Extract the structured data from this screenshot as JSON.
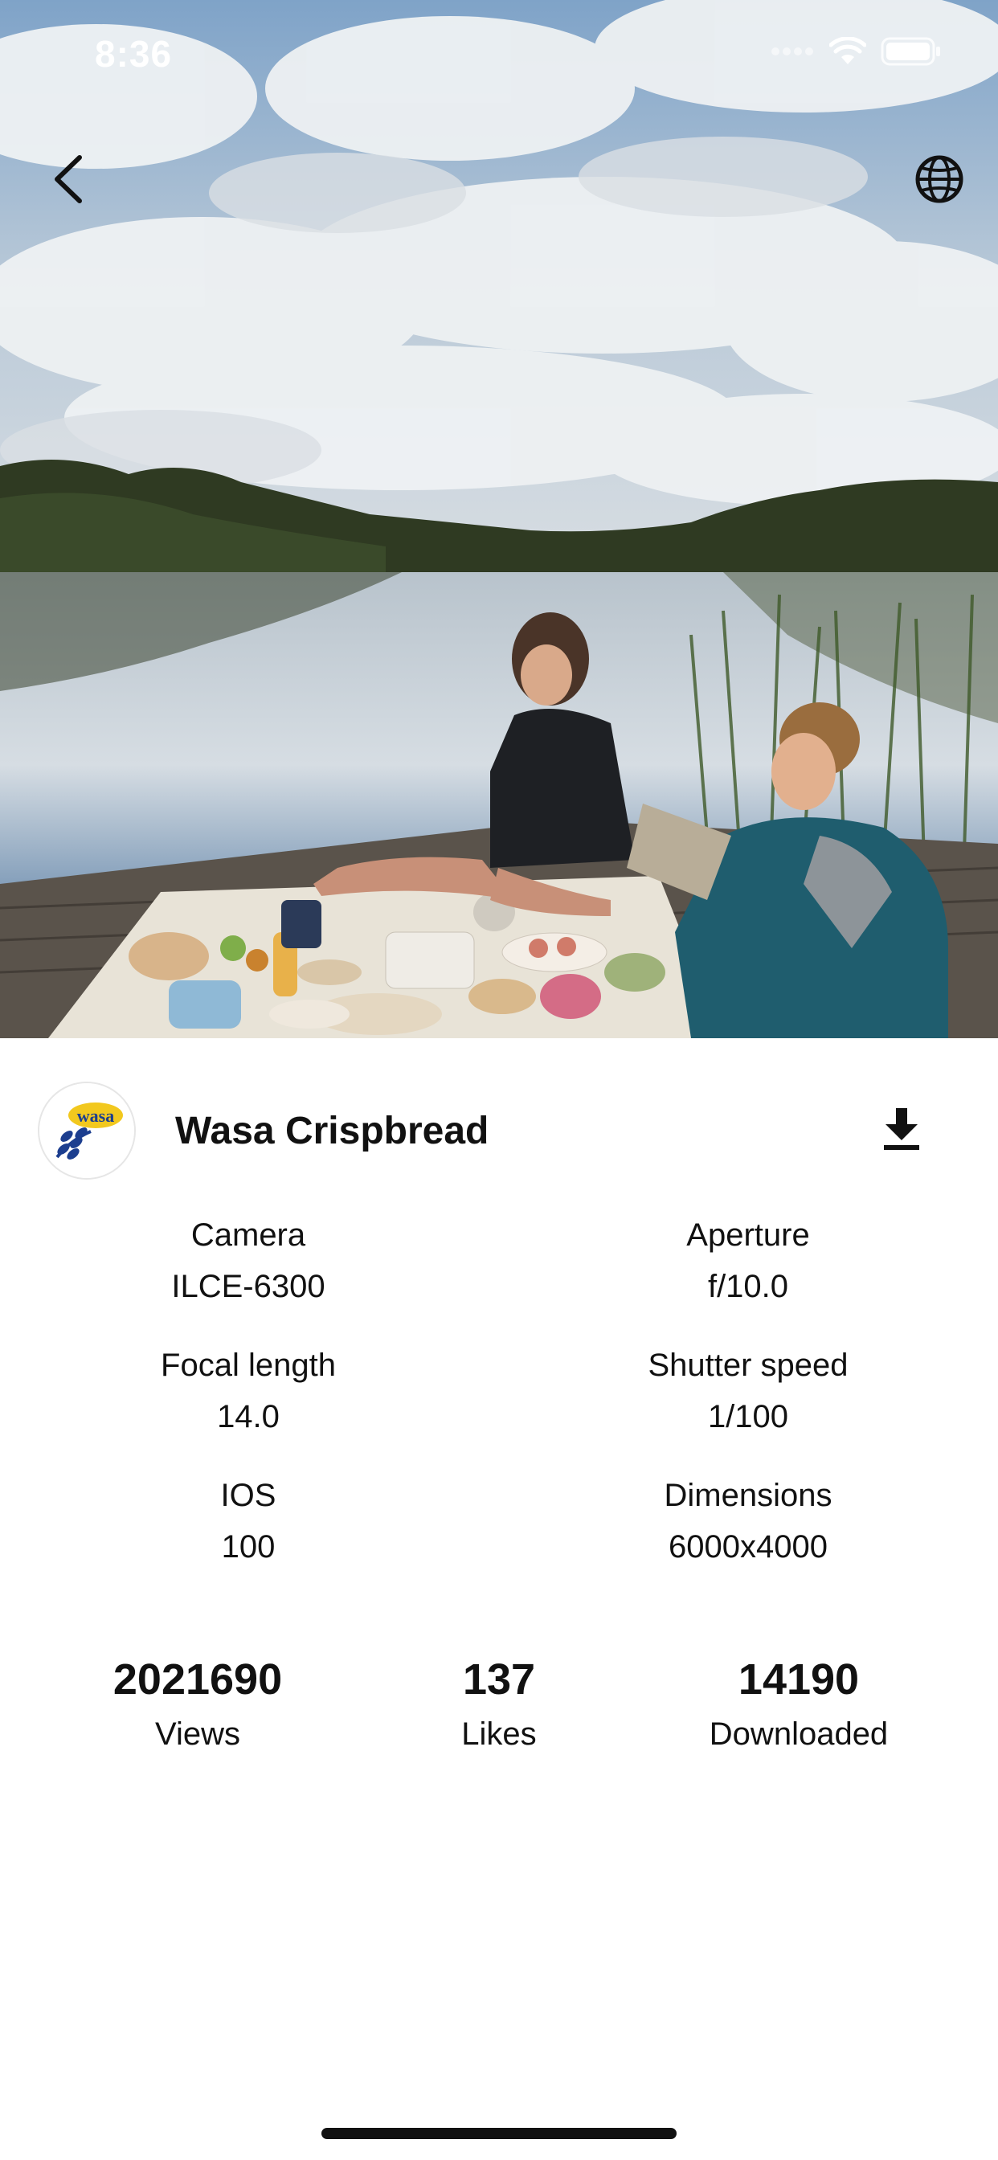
{
  "status_bar": {
    "time": "8:36"
  },
  "author": {
    "name": "Wasa Crispbread",
    "avatar_text": "wasa"
  },
  "exif": [
    {
      "label": "Camera",
      "value": "ILCE-6300"
    },
    {
      "label": "Aperture",
      "value": "f/10.0"
    },
    {
      "label": "Focal length",
      "value": "14.0"
    },
    {
      "label": "Shutter speed",
      "value": "1/100"
    },
    {
      "label": "IOS",
      "value": "100"
    },
    {
      "label": "Dimensions",
      "value": "6000x4000"
    }
  ],
  "stats": [
    {
      "value": "2021690",
      "label": "Views"
    },
    {
      "value": "137",
      "label": "Likes"
    },
    {
      "value": "14190",
      "label": "Downloaded"
    }
  ],
  "icons": {
    "back": "chevron-left-icon",
    "globe": "globe-icon",
    "download": "download-icon"
  },
  "colors": {
    "sky": "#8fb1d3",
    "water": "#c9d3dc",
    "trees": "#2f3a22",
    "dock": "#5a534b",
    "blanket": "#e8e3d7",
    "jacket": "#1f5d6e"
  }
}
